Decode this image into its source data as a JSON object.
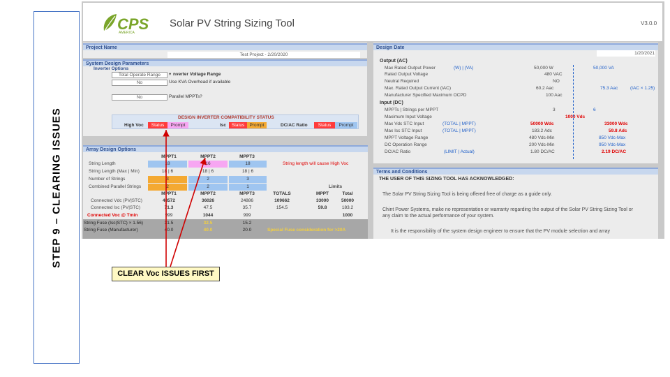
{
  "slide": {
    "side_label": "STEP 9 – CLEARING ISSUES",
    "callout": "CLEAR Voc ISSUES FIRST"
  },
  "app": {
    "logo_text": "CPS",
    "logo_sub": "AMERICA",
    "title": "Solar PV String Sizing Tool",
    "version": "V3.0.0"
  },
  "project": {
    "header": "Project Name",
    "value": "Test Project - 2/20/2020"
  },
  "design_date": {
    "header": "Design Date",
    "value": "1/20/2021"
  },
  "system": {
    "header": "System Design Parameters",
    "inverter_options": "Inverter Options",
    "range_select": "Total Operate Range",
    "range_label": "nverter Voltage Range",
    "kva_value": "No",
    "kva_label": "Use KVA Overhead if available",
    "parallel_value": "No",
    "parallel_label": "Parallel MPPTs?",
    "compat_title": "DESIGN INVERTER COMPATIBILITY STATUS",
    "high_voc": "High Voc",
    "isc": "Isc",
    "dcac": "DC/AC Ratio",
    "status": "Status",
    "prompt": "Prompt"
  },
  "output": {
    "section_ac": "Output (AC)",
    "rows": [
      {
        "label": "Max Rated Output Power",
        "unit": "(W) | (VA)",
        "v1": "50,000 W",
        "v2": "50,000 VA"
      },
      {
        "label": "Rated Output Voltage",
        "unit": "",
        "v1": "480 VAC",
        "v2": ""
      },
      {
        "label": "Neutral Required",
        "unit": "",
        "v1": "NO",
        "v2": ""
      },
      {
        "label": "Max. Rated Output Current (IAC)",
        "unit": "",
        "v1": "60.2 Aac",
        "v2": "75.3 Aac",
        "v3": "(IAC × 1.25)"
      },
      {
        "label": "Manufacturer Specified Maximum OCPD",
        "unit": "",
        "v1": "100 Aac",
        "v2": ""
      }
    ],
    "section_dc": "Input (DC)",
    "dc_rows": [
      {
        "label": "MPPTs | Strings per MPPT",
        "unit": "",
        "v1": "3",
        "v2": "6"
      },
      {
        "label": "Maximum Input Voltage",
        "unit": "",
        "v1": "1000 Vdc",
        "v2": ""
      },
      {
        "label": "Max Vdc STC Input",
        "unit": "(TOTAL | MPPT)",
        "v1": "50000 Wdc",
        "v2": "33000 Wdc"
      },
      {
        "label": "Max Isc STC Input",
        "unit": "(TOTAL | MPPT)",
        "v1": "183.2 Adc",
        "v2": "59.8 Adc"
      },
      {
        "label": "MPPT Voltage Range",
        "unit": "",
        "v1": "480 Vdc-Min",
        "v2": "850 Vdc-Max"
      },
      {
        "label": "DC Operation Range",
        "unit": "",
        "v1": "200 Vdc-Min",
        "v2": "950 Vdc-Max"
      },
      {
        "label": "DC/AC Ratio",
        "unit": "(LIMIT | Actual)",
        "v1": "1.80 DC/AC",
        "v2": "2.19 DC/AC"
      }
    ]
  },
  "array": {
    "header": "Array Design Options",
    "cols": [
      "MPPT1",
      "MPPT2",
      "MPPT3"
    ],
    "rows": [
      {
        "label": "String Length",
        "vals": [
          "18",
          "16",
          "18"
        ]
      },
      {
        "label": "String Length (Max | Min)",
        "vals": [
          "18 | 6",
          "18 | 6",
          "18 | 6"
        ]
      },
      {
        "label": "Number of Strings",
        "vals": [
          "3",
          "2",
          "3"
        ]
      },
      {
        "label": "Combined Parallel Strings",
        "vals": [
          "2",
          "2",
          "1"
        ]
      }
    ],
    "warning": "String length will cause High Voc",
    "limits": "Limits",
    "res_cols": [
      "MPPT1",
      "MPPT2",
      "MPPT3",
      "TOTALS",
      "MPPT",
      "Total"
    ],
    "res_rows": [
      {
        "label": "Connected Vdc (PV|STC)",
        "vals": [
          "48572",
          "36026",
          "24886",
          "109662",
          "33000",
          "50000"
        ]
      },
      {
        "label": "Connected Isc (PV|STC)",
        "vals": [
          "71.3",
          "47.5",
          "35.7",
          "154.5",
          "59.8",
          "183.2"
        ]
      },
      {
        "label": "Connected Voc @ Tmin",
        "vals": [
          "999",
          "1044",
          "999",
          "",
          "",
          "1000"
        ]
      },
      {
        "label": "String Fuse (Isc(STC) × 1.56)",
        "vals": [
          "31.5",
          "32.5",
          "15.2",
          "",
          "",
          ""
        ]
      },
      {
        "label": "String Fuse (Manufacturer)",
        "vals": [
          "40.0",
          "40.0",
          "20.0",
          "",
          "",
          ""
        ]
      }
    ],
    "fuse_note": "Special Fuse consideration for >20A"
  },
  "terms": {
    "header": "Terms and Conditions",
    "title": "THE USER OF THIS SIZING TOOL HAS ACKNOWLEDGED:",
    "p1": "The Solar PV String Sizing Tool is being offered free of charge as a guide only.",
    "p2": "Chint Power Systems, make no representation or warranty regarding the output of the Solar PV String Sizing Tool or any claim to the actual performance of your system.",
    "p3": "It is the responsibility of the system design engineer to ensure that the PV module selection and array"
  },
  "colors": {
    "accent": "#8ea9db",
    "alert_red": "#e00000",
    "prompt_pink": "#f7a6f2",
    "input_blue": "#9fc5f0",
    "input_orange": "#f4a932"
  }
}
